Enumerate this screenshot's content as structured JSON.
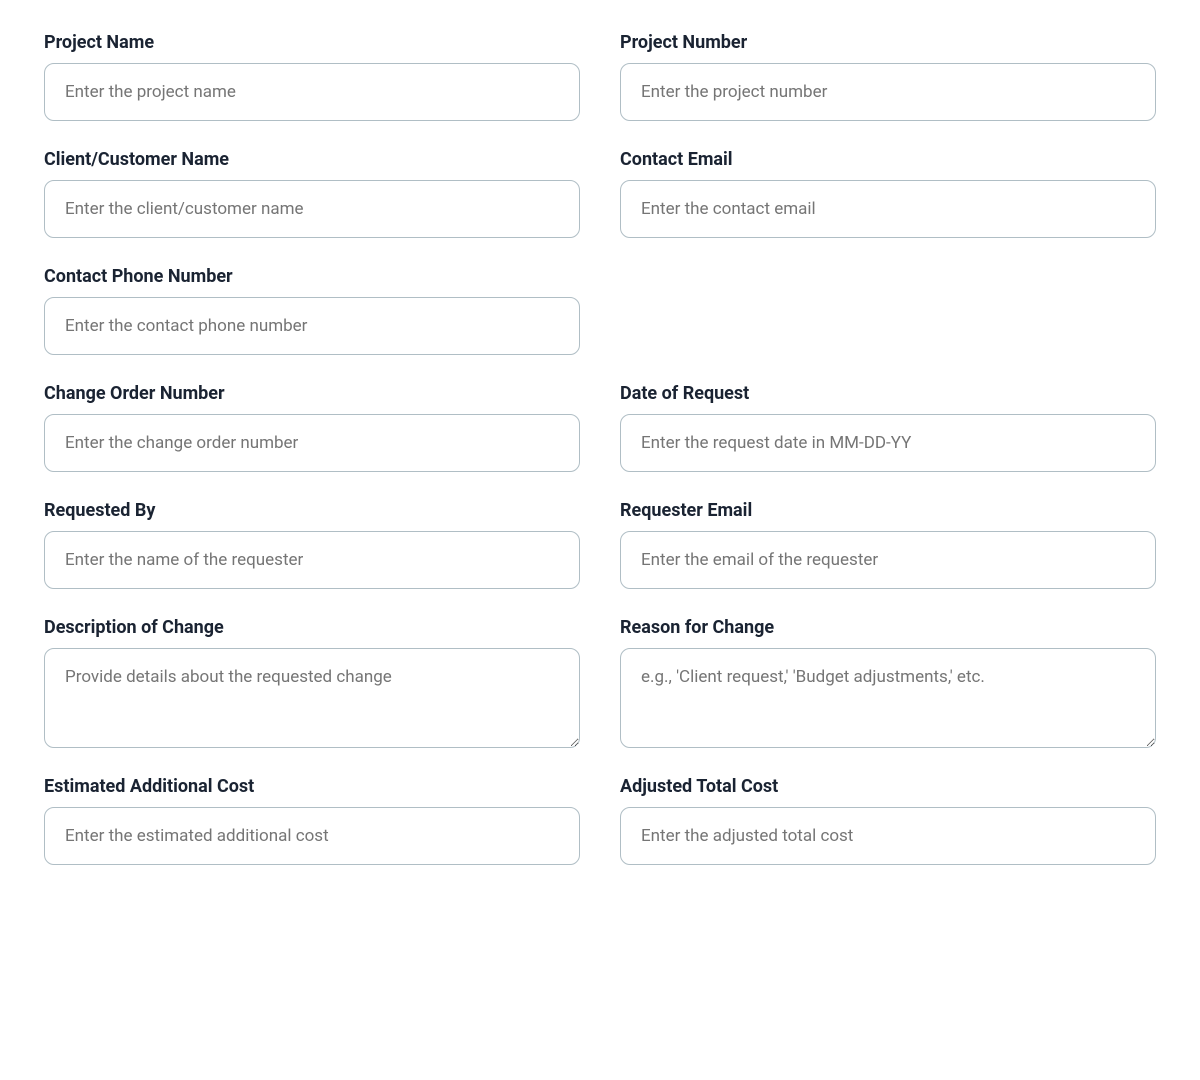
{
  "fields": [
    {
      "id": "project-name",
      "label": "Project Name",
      "placeholder": "Enter the project name",
      "type": "text",
      "col": "left"
    },
    {
      "id": "project-number",
      "label": "Project Number",
      "placeholder": "Enter the project number",
      "type": "text",
      "col": "right"
    },
    {
      "id": "client-customer-name",
      "label": "Client/Customer Name",
      "placeholder": "Enter the client/customer name",
      "type": "text",
      "col": "left"
    },
    {
      "id": "contact-email",
      "label": "Contact Email",
      "placeholder": "Enter the contact email",
      "type": "text",
      "col": "right"
    },
    {
      "id": "contact-phone-number",
      "label": "Contact Phone Number",
      "placeholder": "Enter the contact phone number",
      "type": "text",
      "col": "left",
      "fullWidth": false
    },
    {
      "id": "contact-phone-spacer",
      "label": "",
      "placeholder": "",
      "type": "spacer",
      "col": "right"
    },
    {
      "id": "change-order-number",
      "label": "Change Order Number",
      "placeholder": "Enter the change order number",
      "type": "text",
      "col": "left"
    },
    {
      "id": "date-of-request",
      "label": "Date of Request",
      "placeholder": "Enter the request date in MM-DD-YY",
      "type": "text",
      "col": "right"
    },
    {
      "id": "requested-by",
      "label": "Requested By",
      "placeholder": "Enter the name of the requester",
      "type": "text",
      "col": "left"
    },
    {
      "id": "requester-email",
      "label": "Requester Email",
      "placeholder": "Enter the email of the requester",
      "type": "text",
      "col": "right"
    },
    {
      "id": "description-of-change",
      "label": "Description of Change",
      "placeholder": "Provide details about the requested change",
      "type": "textarea",
      "col": "left"
    },
    {
      "id": "reason-for-change",
      "label": "Reason for Change",
      "placeholder": "e.g., 'Client request,' 'Budget adjustments,' etc.",
      "type": "textarea",
      "col": "right"
    },
    {
      "id": "estimated-additional-cost",
      "label": "Estimated Additional Cost",
      "placeholder": "Enter the estimated additional cost",
      "type": "text",
      "col": "left"
    },
    {
      "id": "adjusted-total-cost",
      "label": "Adjusted Total Cost",
      "placeholder": "Enter the adjusted total cost",
      "type": "text",
      "col": "right"
    }
  ]
}
